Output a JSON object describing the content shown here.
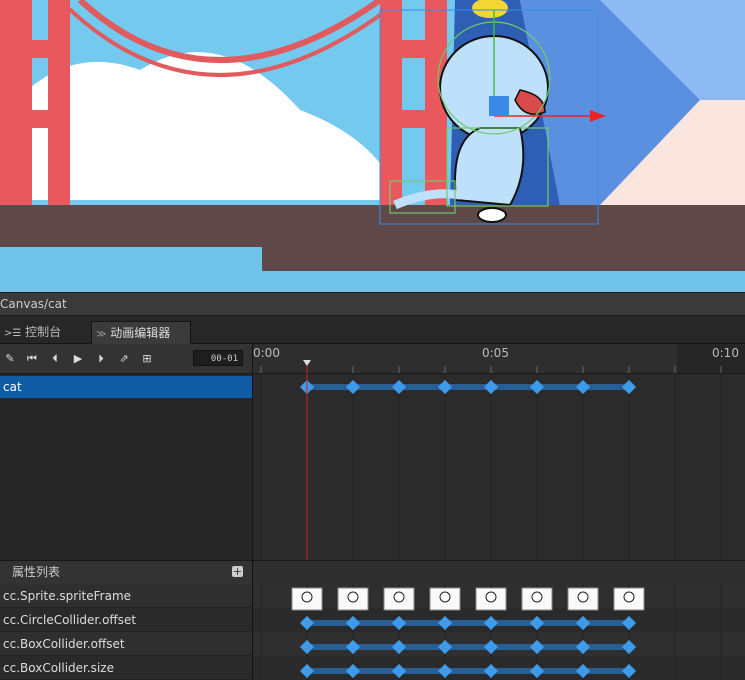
{
  "breadcrumb": "Canvas/cat",
  "tabs": [
    {
      "label": "控制台",
      "icon": "console-icon",
      "active": false
    },
    {
      "label": "动画编辑器",
      "icon": "animation-icon",
      "active": true
    }
  ],
  "toolbar": {
    "buttons": [
      "edit-icon",
      "jump-to-start-icon",
      "previous-frame-icon",
      "play-icon",
      "next-frame-icon",
      "add-event-icon",
      "add-clip-icon"
    ],
    "time_value": "00-01"
  },
  "ruler": {
    "labels": [
      {
        "text": "0:00",
        "sec": 0
      },
      {
        "text": "0:05",
        "sec": 5
      },
      {
        "text": "0:10",
        "sec": 10
      }
    ],
    "current_frame_sec": 1
  },
  "nodes": [
    {
      "name": "cat",
      "selected": true,
      "keyframes_sec": [
        1,
        2,
        3,
        4,
        5,
        6,
        7,
        8
      ]
    }
  ],
  "properties": {
    "header": "属性列表",
    "add_icon": "plus-icon",
    "rows": [
      {
        "name": "cc.Sprite.spriteFrame",
        "type": "sprite",
        "keyframes_sec": [
          1,
          2,
          3,
          4,
          5,
          6,
          7,
          8
        ]
      },
      {
        "name": "cc.CircleCollider.offset",
        "type": "value",
        "keyframes_sec": [
          1,
          2,
          3,
          4,
          5,
          6,
          7,
          8
        ]
      },
      {
        "name": "cc.BoxCollider.offset",
        "type": "value",
        "keyframes_sec": [
          1,
          2,
          3,
          4,
          5,
          6,
          7,
          8
        ]
      },
      {
        "name": "cc.BoxCollider.size",
        "type": "value",
        "keyframes_sec": [
          1,
          2,
          3,
          4,
          5,
          6,
          7,
          8
        ]
      }
    ]
  },
  "colors": {
    "keyframe": "#3d9be9",
    "curve": "#2a5f94",
    "playhead": "#c82323",
    "selection": "#0f5ba5"
  }
}
